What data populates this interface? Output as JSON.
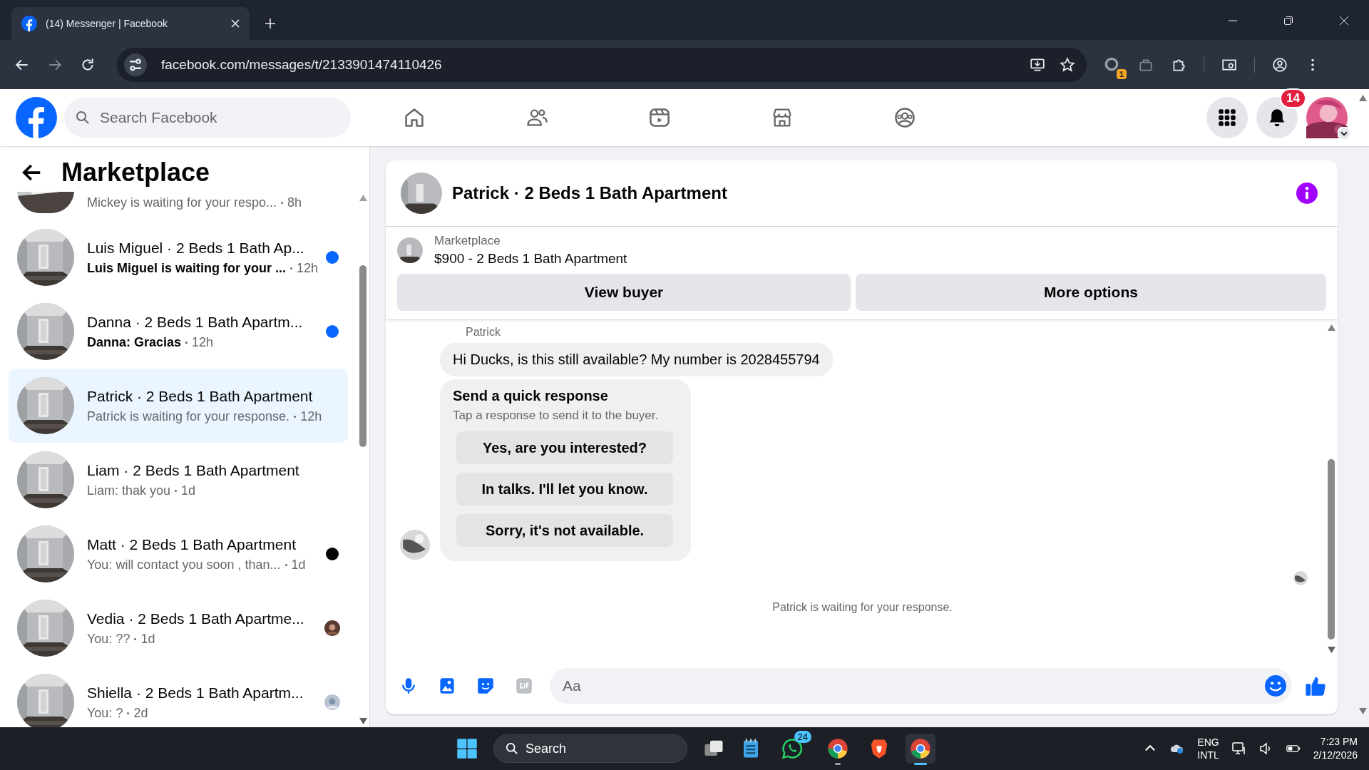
{
  "browser": {
    "tab_title": "(14) Messenger | Facebook",
    "url": "facebook.com/messages/t/2133901474110426",
    "extension_badge": "1"
  },
  "header": {
    "search_placeholder": "Search Facebook",
    "notification_count": "14"
  },
  "sidebar": {
    "title": "Marketplace",
    "partial_row": {
      "preview": "Mickey is waiting for your respo...",
      "time": "8h"
    },
    "conversations": [
      {
        "title": "Luis Miguel · 2 Beds 1 Bath Ap...",
        "preview": "Luis Miguel is waiting for your ...",
        "time": "12h",
        "unread": true,
        "selected": false,
        "indicator": {
          "kind": "dot",
          "color": "#0866ff"
        }
      },
      {
        "title": "Danna · 2 Beds 1 Bath Apartm...",
        "preview": "Danna: Gracias",
        "time": "12h",
        "unread": true,
        "selected": false,
        "indicator": {
          "kind": "dot",
          "color": "#0866ff"
        }
      },
      {
        "title": "Patrick · 2 Beds 1 Bath Apartment",
        "preview": "Patrick is waiting for your response.",
        "time": "12h",
        "unread": false,
        "selected": true
      },
      {
        "title": "Liam · 2 Beds 1 Bath Apartment",
        "preview": "Liam: thak you",
        "time": "1d",
        "unread": false,
        "selected": false
      },
      {
        "title": "Matt · 2 Beds 1 Bath Apartment",
        "preview": "You: will contact you soon , than...",
        "time": "1d",
        "unread": false,
        "selected": false,
        "indicator": {
          "kind": "dot",
          "color": "#050505"
        }
      },
      {
        "title": "Vedia · 2 Beds 1 Bath Apartme...",
        "preview": "You: ??",
        "time": "1d",
        "unread": false,
        "selected": false,
        "indicator": {
          "kind": "seen"
        }
      },
      {
        "title": "Shiella · 2 Beds 1 Bath Apartm...",
        "preview": "You: ?",
        "time": "2d",
        "unread": false,
        "selected": false,
        "indicator": {
          "kind": "seen"
        }
      }
    ]
  },
  "chat": {
    "title": "Patrick · 2 Beds 1 Bath Apartment",
    "listing": {
      "label": "Marketplace",
      "name": "$900 - 2 Beds 1 Bath Apartment"
    },
    "actions": [
      "View buyer",
      "More options"
    ],
    "sender": "Patrick",
    "message": "Hi Ducks, is this still available? My number is 2028455794",
    "quick_response": {
      "title": "Send a quick response",
      "subtitle": "Tap a response to send it to the buyer.",
      "options": [
        "Yes, are you interested?",
        "In talks. I'll let you know.",
        "Sorry, it's not available."
      ]
    },
    "status": "Patrick is waiting for your response.",
    "composer_placeholder": "Aa"
  },
  "taskbar": {
    "search": "Search",
    "whatsapp_badge": "24",
    "language": "ENG",
    "layout": "INTL",
    "time": "7:23 PM",
    "date": "2/12/2026"
  }
}
